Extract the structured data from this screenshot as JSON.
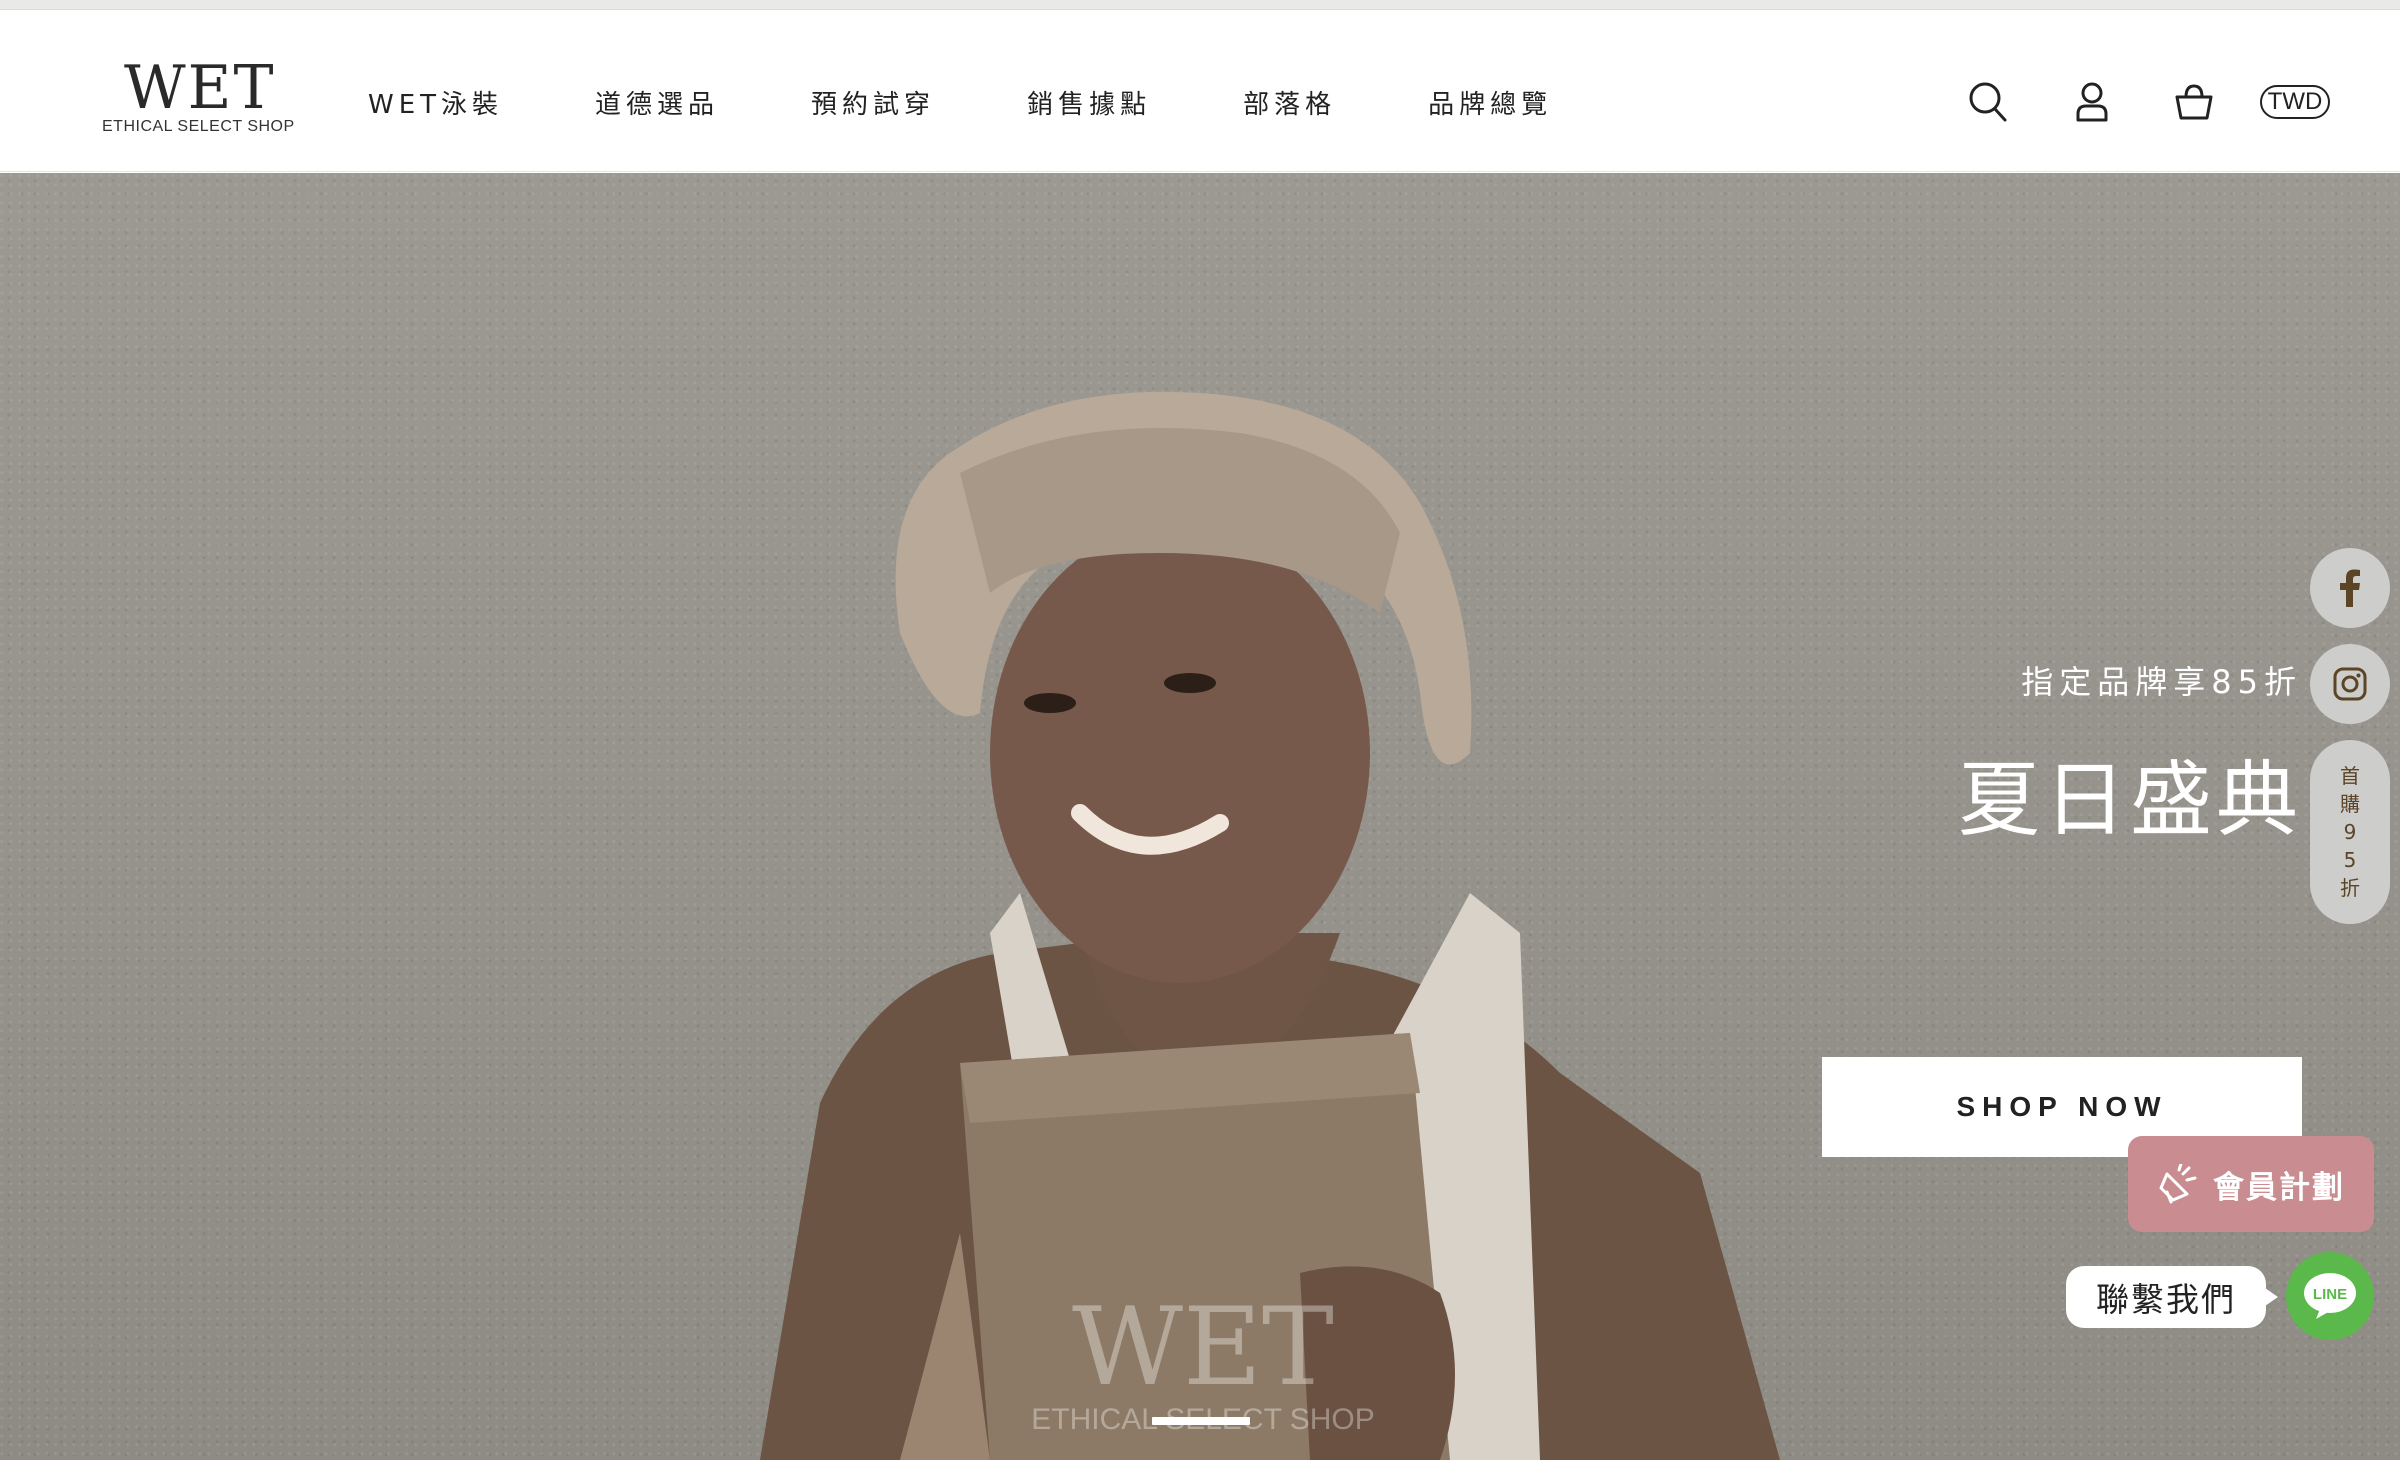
{
  "header": {
    "logo_word": "WET",
    "logo_sub": "ETHICAL SELECT SHOP",
    "nav": [
      {
        "label": "WET泳裝"
      },
      {
        "label": "道德選品"
      },
      {
        "label": "預約試穿"
      },
      {
        "label": "銷售據點"
      },
      {
        "label": "部落格"
      },
      {
        "label": "品牌總覽"
      }
    ],
    "currency": "TWD",
    "icons": [
      "search-icon",
      "user-icon",
      "shopping-bag-icon"
    ]
  },
  "hero": {
    "subtitle": "指定品牌享85折",
    "title": "夏日盛典",
    "cta": "SHOP NOW",
    "watermark_word": "WET",
    "watermark_sub": "ETHICAL SELECT SHOP",
    "slides_total": 1,
    "active_slide": 1
  },
  "side_rail": {
    "items": [
      {
        "icon": "facebook-icon"
      },
      {
        "icon": "instagram-icon"
      }
    ],
    "promo_chars": [
      "首",
      "購",
      "9",
      "5",
      "折"
    ]
  },
  "member": {
    "label": "會員計劃",
    "icon": "megaphone-icon"
  },
  "contact": {
    "label": "聯繫我們",
    "line_label": "LINE"
  },
  "colors": {
    "member_bg": "#c98c90",
    "line_green": "#5bb94b",
    "rail_bg": "#cdcdcb",
    "hero_bg": "#97948d"
  }
}
